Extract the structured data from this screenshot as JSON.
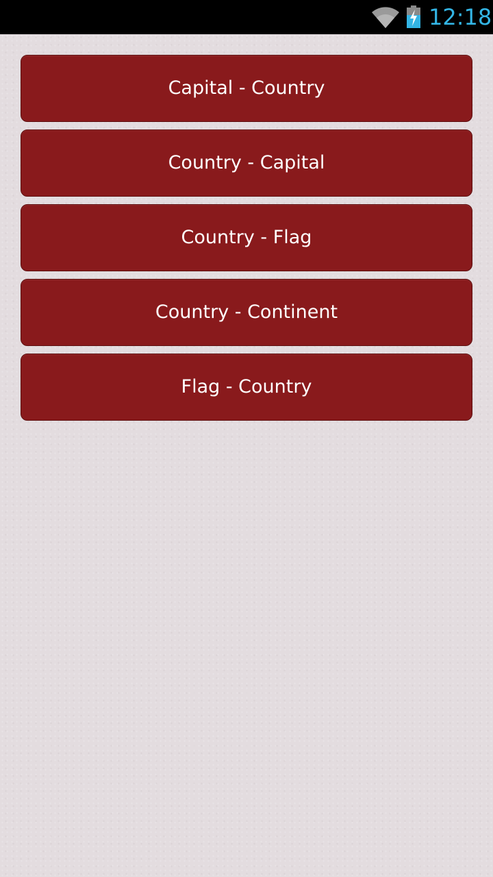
{
  "status_bar": {
    "time": "12:18",
    "wifi_icon": "wifi-icon",
    "battery_icon": "battery-charging-icon",
    "time_color": "#33b5e5"
  },
  "menu": {
    "button_color": "#891a1c",
    "items": [
      {
        "label": "Capital - Country"
      },
      {
        "label": "Country - Capital"
      },
      {
        "label": "Country - Flag"
      },
      {
        "label": "Country - Continent"
      },
      {
        "label": "Flag - Country"
      }
    ]
  }
}
